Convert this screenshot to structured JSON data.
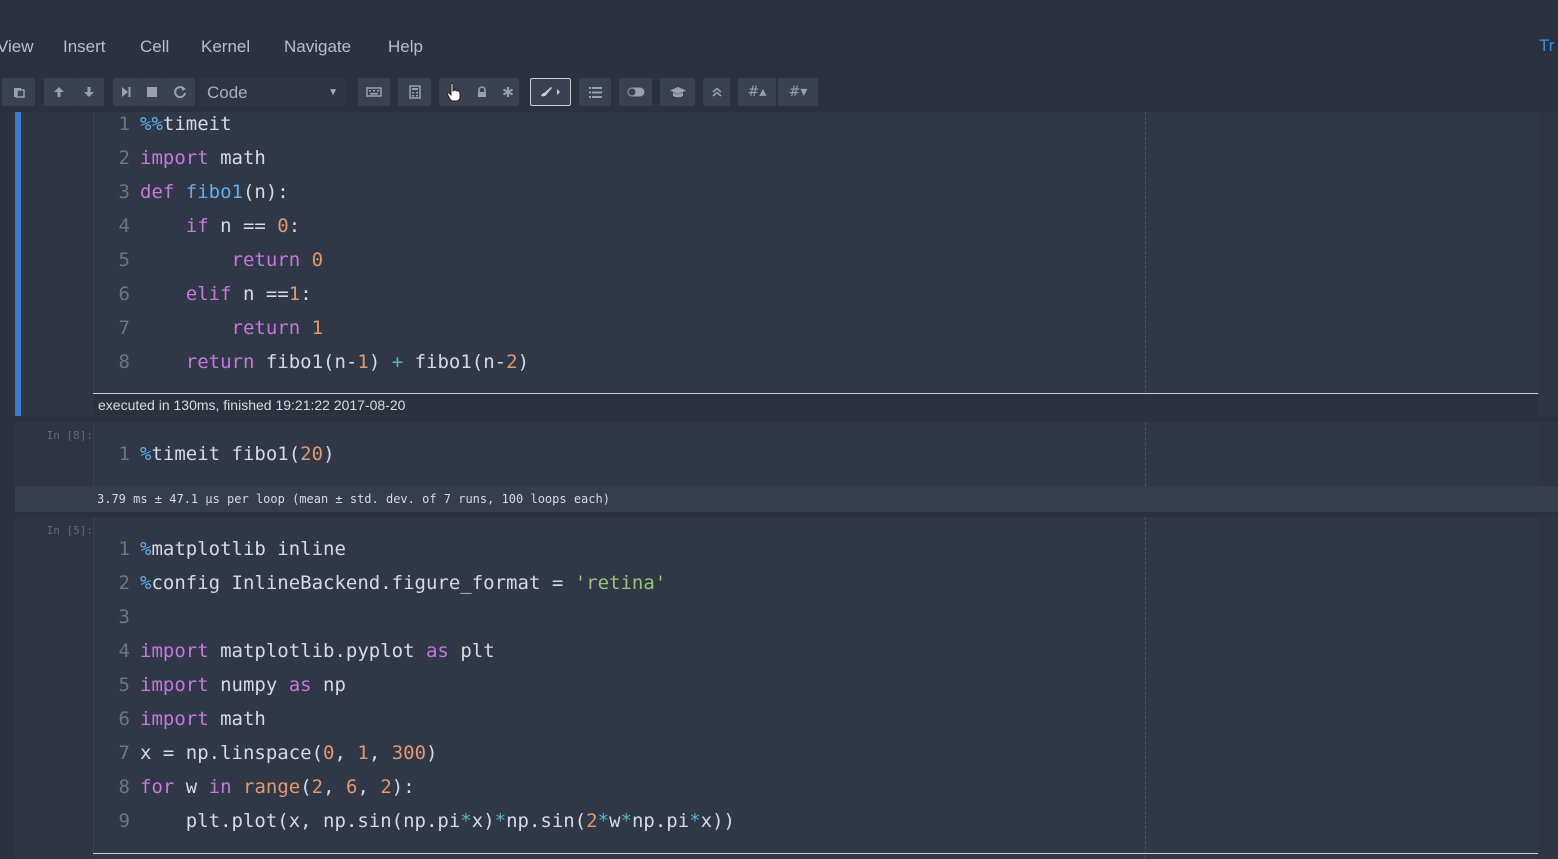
{
  "menu": {
    "items": [
      "View",
      "Insert",
      "Cell",
      "Kernel",
      "Navigate",
      "Help"
    ],
    "right_link": "Tr"
  },
  "toolbar": {
    "cell_type": "Code",
    "icons": [
      "paste-icon",
      "move-up-icon",
      "move-down-icon",
      "run-next-icon",
      "stop-icon",
      "restart-icon",
      "keyboard-icon",
      "calculator-icon",
      "hand-pointer-icon",
      "lock-icon",
      "asterisk-icon",
      "paintbrush-icon",
      "list-icon",
      "toggle-icon",
      "graduation-cap-icon",
      "collapse-up-icon",
      "heading-up-icon",
      "heading-down-icon"
    ]
  },
  "cells": [
    {
      "prompt": "",
      "lines": [
        {
          "n": "1",
          "code": "%%timeit"
        },
        {
          "n": "2",
          "code": "import math"
        },
        {
          "n": "3",
          "code": "def fibo1(n):"
        },
        {
          "n": "4",
          "code": "    if n == 0:"
        },
        {
          "n": "5",
          "code": "        return 0"
        },
        {
          "n": "6",
          "code": "    elif n ==1:"
        },
        {
          "n": "7",
          "code": "        return 1"
        },
        {
          "n": "8",
          "code": "    return fibo1(n-1) + fibo1(n-2)"
        }
      ],
      "exec_info": "executed in 130ms, finished 19:21:22 2017-08-20"
    },
    {
      "prompt": "In [8]:",
      "lines": [
        {
          "n": "1",
          "code": "%timeit fibo1(20)"
        }
      ],
      "output": "3.79 ms ± 47.1 µs per loop (mean ± std. dev. of 7 runs, 100 loops each)"
    },
    {
      "prompt": "In [5]:",
      "lines": [
        {
          "n": "1",
          "code": "%matplotlib inline"
        },
        {
          "n": "2",
          "code": "%config InlineBackend.figure_format = 'retina'"
        },
        {
          "n": "3",
          "code": ""
        },
        {
          "n": "4",
          "code": "import matplotlib.pyplot as plt"
        },
        {
          "n": "5",
          "code": "import numpy as np"
        },
        {
          "n": "6",
          "code": "import math"
        },
        {
          "n": "7",
          "code": "x = np.linspace(0, 1, 300)"
        },
        {
          "n": "8",
          "code": "for w in range(2, 6, 2):"
        },
        {
          "n": "9",
          "code": "    plt.plot(x, np.sin(np.pi*x)*np.sin(2*w*np.pi*x))"
        }
      ]
    }
  ],
  "colors": {
    "background": "#2b313d",
    "cell": "#2f3542",
    "selected_bar": "#3e7ad1",
    "keyword": "#c678dd",
    "number": "#e09a6e",
    "function": "#61afef",
    "string": "#98c379"
  }
}
